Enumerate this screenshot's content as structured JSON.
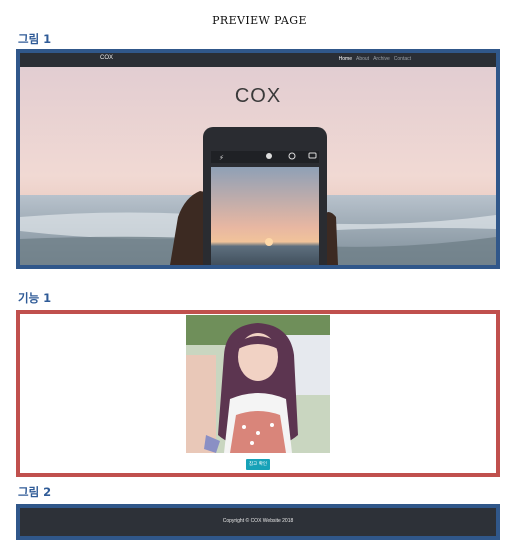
{
  "page": {
    "title": "PREVIEW  PAGE"
  },
  "sections": {
    "figure1_label": "그림  1",
    "feature1_label": "기능  1",
    "figure2_label": "그림  2"
  },
  "hero": {
    "brand": "COX",
    "nav": [
      "Home",
      "About",
      "Archive",
      "Contact"
    ],
    "title": "COX"
  },
  "feature": {
    "button_label": "참고 확인"
  },
  "footer": {
    "copyright": "Copyright © COX Website 2018"
  },
  "colors": {
    "section_label": "#2f5b97",
    "frame_blue": "#30578a",
    "frame_red": "#c0504d",
    "navbar": "#2a2e35",
    "button": "#17a2b8"
  }
}
